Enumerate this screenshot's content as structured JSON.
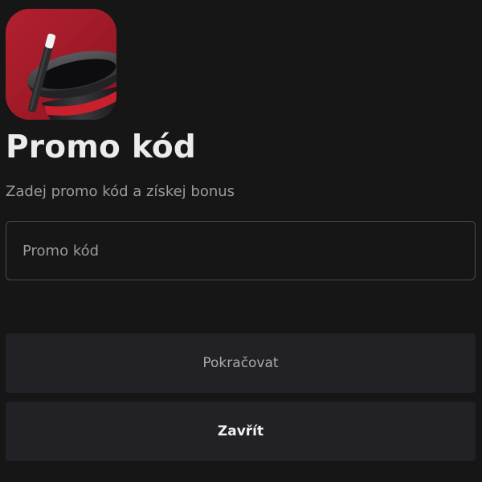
{
  "app_icon": {
    "icon": "magic-hat-wand-icon"
  },
  "header": {
    "title": "Promo kód",
    "subtitle": "Zadej promo kód a získej bonus"
  },
  "form": {
    "promo_input": {
      "value": "",
      "placeholder": "Promo kód"
    }
  },
  "actions": {
    "continue_label": "Pokračovat",
    "close_label": "Zavřít"
  },
  "colors": {
    "background": "#161616",
    "icon_background": "#a91b2b",
    "button_background": "#222126",
    "input_border": "#4a4a4f"
  }
}
